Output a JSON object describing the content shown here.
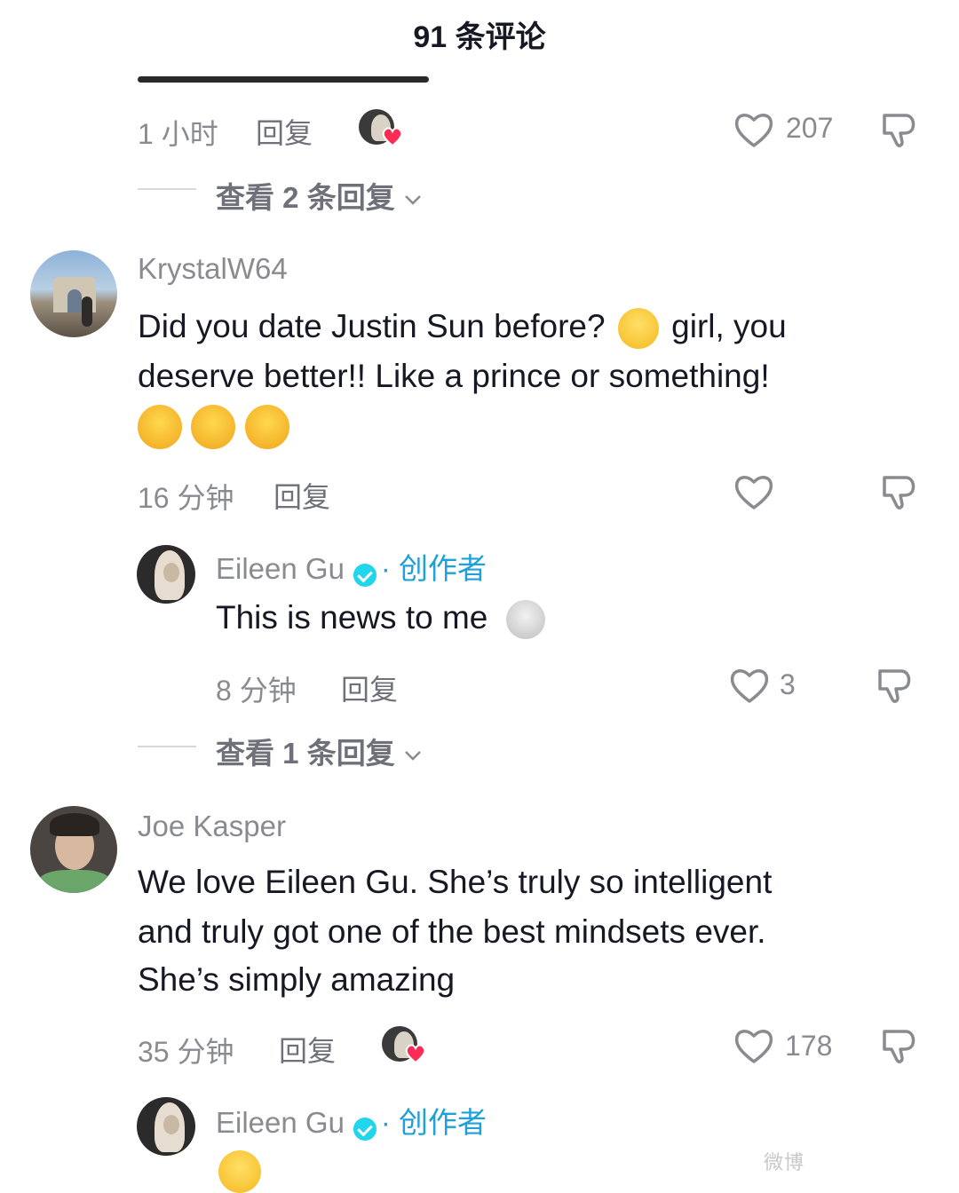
{
  "header": {
    "title": "91 条评论"
  },
  "comments": [
    {
      "time": "1 小时",
      "reply_label": "回复",
      "likes": "207",
      "view_replies": "查看 2 条回复"
    },
    {
      "username": "KrystalW64",
      "text_1": "Did you date Justin Sun before?",
      "text_2": "girl, you",
      "text_3": "deserve better!! Like a prince or something!",
      "time": "16 分钟",
      "reply_label": "回复",
      "reply": {
        "username": "Eileen Gu",
        "creator_tag": "· 创作者",
        "text": "This is news to me",
        "time": "8 分钟",
        "reply_label": "回复",
        "likes": "3"
      },
      "view_replies": "查看 1 条回复"
    },
    {
      "username": "Joe Kasper",
      "text_1": "We love Eileen Gu. She’s truly so intelligent",
      "text_2": "and truly got one of the best mindsets ever.",
      "text_3": "She’s simply amazing",
      "time": "35 分钟",
      "reply_label": "回复",
      "likes": "178",
      "reply": {
        "username": "Eileen Gu",
        "creator_tag": "· 创作者"
      }
    }
  ],
  "icons": {
    "like": "heart-outline-icon",
    "dislike": "thumbs-down-icon",
    "chevron": "chevron-down-icon",
    "verified": "verified-badge-icon",
    "creator_liked": "creator-liked-heart-icon"
  },
  "colors": {
    "accent": "#1fa0d8",
    "heart": "#fe2c55",
    "muted": "#8a8b91",
    "verified": "#20d5ec"
  },
  "watermark": "微博"
}
